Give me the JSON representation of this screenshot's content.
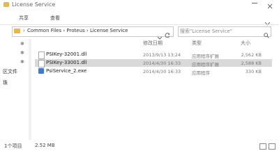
{
  "window": {
    "title": "License Service"
  },
  "ribbon": {
    "tabs": [
      "共享",
      "查看"
    ]
  },
  "address": {
    "crumbs": [
      "Common Files",
      "Proteus",
      "License Service"
    ],
    "separator": "›"
  },
  "search": {
    "placeholder": "搜索\"License Service\""
  },
  "columns": {
    "date": "修改日期",
    "type": "类型",
    "size": "大小"
  },
  "sidebar": {
    "items": [
      "区文件",
      "珠"
    ]
  },
  "files": [
    {
      "name": "PSIKey-32001.dll",
      "date": "2013/9/13 13:24",
      "type": "应用程序扩展",
      "size": "2,562 KB",
      "selected": false
    },
    {
      "name": "PSIKey-33001.dll",
      "date": "2014/4/30 16:33",
      "type": "应用程序扩展",
      "size": "2,588 KB",
      "selected": true
    },
    {
      "name": "PsiService_2.exe",
      "date": "2014/4/30 16:33",
      "type": "应用程序",
      "size": "330 KB",
      "selected": false
    }
  ],
  "status": {
    "selection": "1个项目",
    "size": "2.52 MB"
  },
  "colors": {
    "selection": "#d9d9d9",
    "folder": "#e8b94a"
  }
}
